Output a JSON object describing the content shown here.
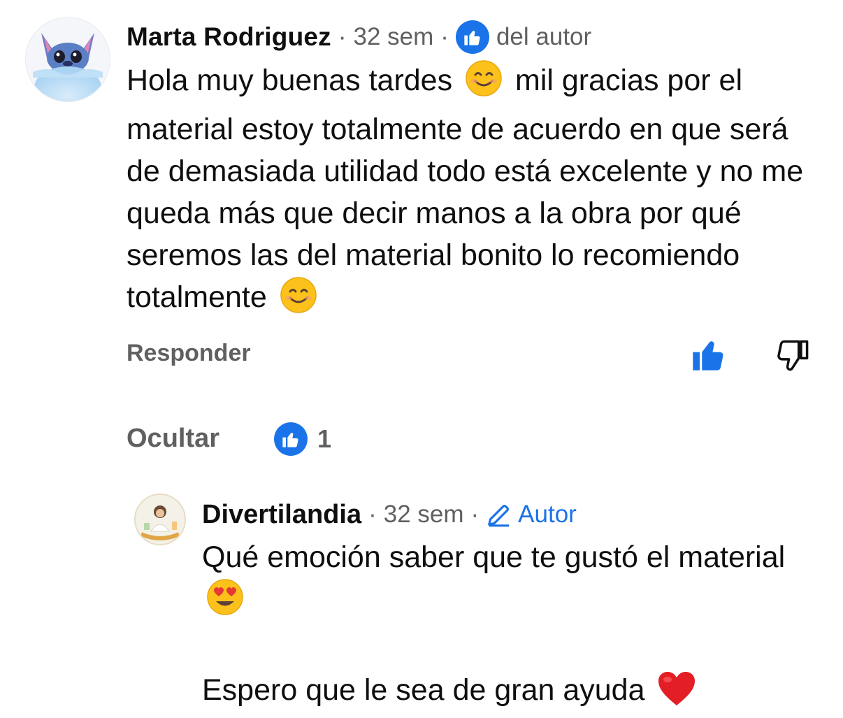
{
  "comment": {
    "author": "Marta Rodriguez",
    "time": "32 sem",
    "heart_badge": "del autor",
    "text_1": "Hola muy buenas tardes",
    "text_2": "mil gracias por el material estoy totalmente de acuerdo en que será de demasiada utilidad todo está excelente y no me queda más que decir manos a la obra por qué seremos las del material bonito lo recomiendo totalmente",
    "reply_label": "Responder",
    "hide_label": "Ocultar",
    "like_count": "1"
  },
  "reply": {
    "author": "Divertilandia",
    "time": "32 sem",
    "badge": "Autor",
    "text_1": "Qué emoción saber que te gustó el material",
    "text_2": "Espero que le sea de gran ayuda"
  },
  "icons": {
    "avatar_main": "stitch-avatar",
    "avatar_reply": "divertilandia-avatar",
    "heart_badge": "thumbs-up-icon",
    "like": "thumbs-up-icon",
    "dislike": "thumbs-down-icon",
    "author_badge": "pencil-icon"
  },
  "colors": {
    "accent_blue": "#1a73e8",
    "secondary_text": "#606060"
  }
}
